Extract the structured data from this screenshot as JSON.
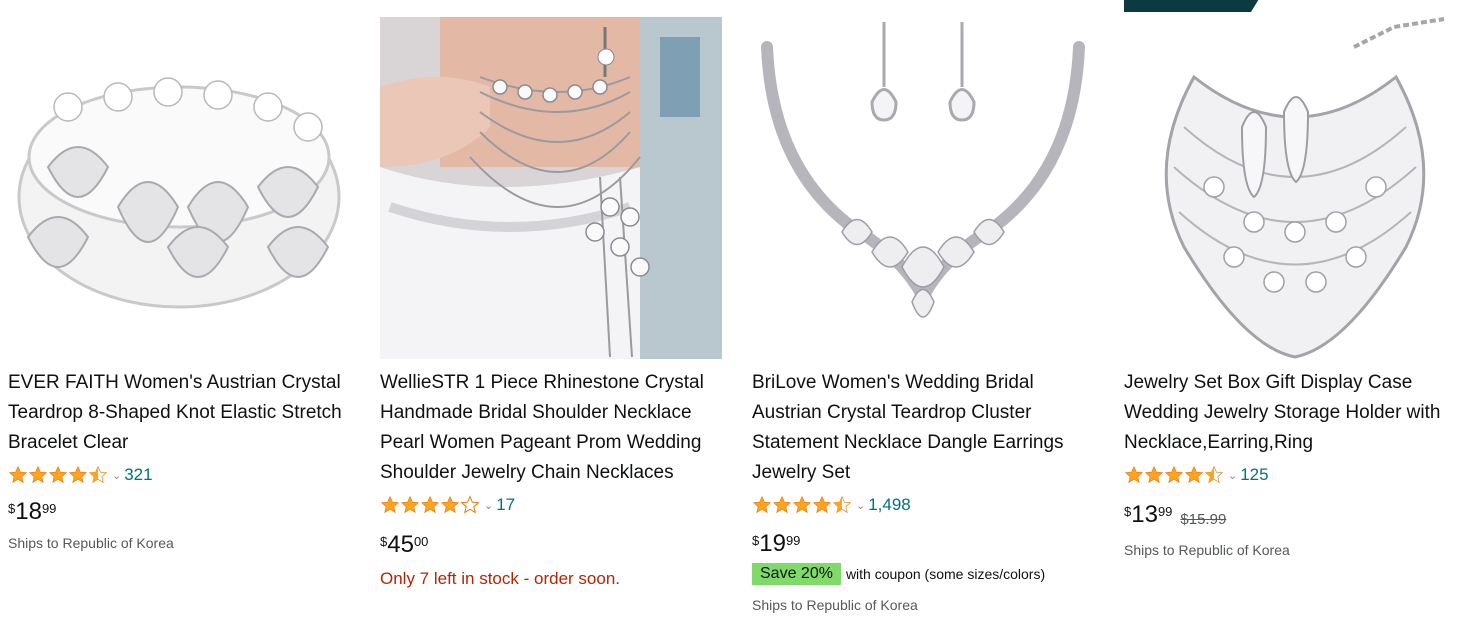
{
  "products": [
    {
      "title": "EVER FAITH Women's Austrian Crystal Teardrop 8-Shaped Knot Elastic Stretch Bracelet Clear",
      "rating": 4.5,
      "review_count": "321",
      "price_symbol": "$",
      "price_whole": "18",
      "price_fraction": "99",
      "shipping": "Ships to Republic of Korea",
      "image_icon": "crystal-bracelet-image"
    },
    {
      "title": "WellieSTR 1 Piece Rhinestone Crystal Handmade Bridal Shoulder Necklace Pearl Women Pageant Prom Wedding Shoulder Jewelry Chain Necklaces",
      "rating": 4.0,
      "review_count": "17",
      "price_symbol": "$",
      "price_whole": "45",
      "price_fraction": "00",
      "stock_message": "Only 7 left in stock - order soon.",
      "image_icon": "shoulder-necklace-photo"
    },
    {
      "title": "BriLove Women's Wedding Bridal Austrian Crystal Teardrop Cluster Statement Necklace Dangle Earrings Jewelry Set",
      "rating": 4.5,
      "review_count": "1,498",
      "price_symbol": "$",
      "price_whole": "19",
      "price_fraction": "99",
      "coupon_badge": "Save 20%",
      "coupon_text": "with coupon (some sizes/colors)",
      "shipping": "Ships to Republic of Korea",
      "image_icon": "necklace-earrings-set-image"
    },
    {
      "title": "Jewelry Set Box Gift Display Case Wedding Jewelry Storage Holder with Necklace,Earring,Ring",
      "rating": 4.5,
      "review_count": "125",
      "price_symbol": "$",
      "price_whole": "13",
      "price_fraction": "99",
      "list_price": "$15.99",
      "shipping": "Ships to Republic of Korea",
      "image_icon": "bib-necklace-set-image"
    }
  ],
  "colors": {
    "star": "#FFA41C",
    "link": "#007185",
    "stock_warning": "#B12704",
    "coupon_badge": "#7FDA69",
    "secondary_text": "#565959"
  }
}
